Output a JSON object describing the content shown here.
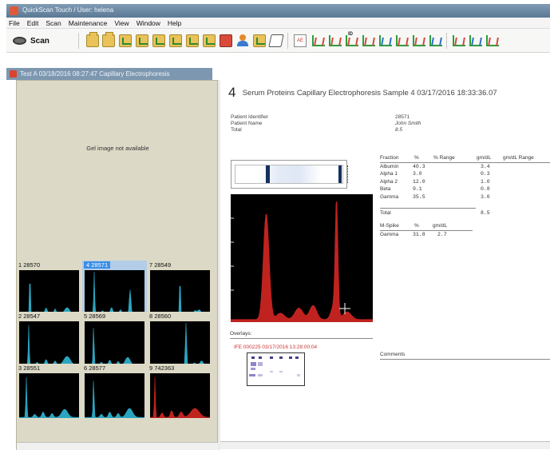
{
  "window": {
    "title": "QuickScan Touch  /  User: helena"
  },
  "menu": [
    "File",
    "Edit",
    "Scan",
    "Maintenance",
    "View",
    "Window",
    "Help"
  ],
  "toolbar": {
    "scan_label": "Scan",
    "icons": [
      "open-folder-icon",
      "folder-icon",
      "patient-list-icon",
      "edit-patient-icon",
      "report-icon",
      "report-icon",
      "report-icon",
      "export-icon",
      "reject-icon",
      "user-icon",
      "monitor-icon",
      "print-icon",
      "scale-icon",
      "peak-icon",
      "peak-icon",
      "peak-id-icon",
      "peak-icon",
      "peak-icon",
      "peak-icon",
      "peak-icon",
      "peak-icon",
      "peak-icon",
      "peak-icon"
    ],
    "peak_id_label": "ID",
    "scale_label": "AE"
  },
  "document": {
    "title": "Test A  03/18/2016  08:27:47  Capillary Electrophoresis"
  },
  "gel": {
    "message": "Gel image not available"
  },
  "thumbnails": [
    {
      "num": "1",
      "id": "28570",
      "selected": false,
      "color": "#2aa5c0"
    },
    {
      "num": "4",
      "id": "28571",
      "selected": true,
      "color": "#2aa5c0"
    },
    {
      "num": "7",
      "id": "28549",
      "selected": false,
      "color": "#2aa5c0"
    },
    {
      "num": "2",
      "id": "28547",
      "selected": false,
      "color": "#2aa5c0"
    },
    {
      "num": "5",
      "id": "28569",
      "selected": false,
      "color": "#2aa5c0"
    },
    {
      "num": "8",
      "id": "28560",
      "selected": false,
      "color": "#2aa5c0"
    },
    {
      "num": "3",
      "id": "28551",
      "selected": false,
      "color": "#2aa5c0"
    },
    {
      "num": "6",
      "id": "28577",
      "selected": false,
      "color": "#2aa5c0"
    },
    {
      "num": "9",
      "id": "742363",
      "selected": false,
      "color": "#c0231f"
    }
  ],
  "report": {
    "sample_number": "4",
    "heading": "Serum Proteins Capillary Electrophoresis Sample 4 03/17/2016 18:33:36.07",
    "labels": {
      "patient_identifier": "Patient Identifier",
      "patient_name": "Patient Name",
      "total": "Total"
    },
    "values": {
      "patient_identifier": "28571",
      "patient_name": "John Smith",
      "total": "8.5"
    },
    "trace_color": "#c0231f",
    "fractions": {
      "headers": [
        "Fraction",
        "%",
        "% Range",
        "gm/dL",
        "gm/dL Range"
      ],
      "rows": [
        {
          "name": "Albumin",
          "pct": "40.3",
          "gmdl": "3.4"
        },
        {
          "name": "Alpha 1",
          "pct": "3.0",
          "gmdl": "0.3"
        },
        {
          "name": "Alpha 2",
          "pct": "12.0",
          "gmdl": "1.0"
        },
        {
          "name": "Beta",
          "pct": "9.1",
          "gmdl": "0.8"
        },
        {
          "name": "Gamma",
          "pct": "35.5",
          "gmdl": "3.0"
        }
      ],
      "total_label": "Total",
      "total_value": "8.5"
    },
    "mspike": {
      "headers": [
        "M-Spike",
        "%",
        "gm/dL"
      ],
      "row": {
        "name": "Gamma",
        "pct": "31.8",
        "gmdl": "2.7"
      }
    },
    "overlays_label": "Overlays:",
    "ife_entry": "IFE  000225  03/17/2016  13:28:00:04",
    "comments_label": "Comments"
  }
}
